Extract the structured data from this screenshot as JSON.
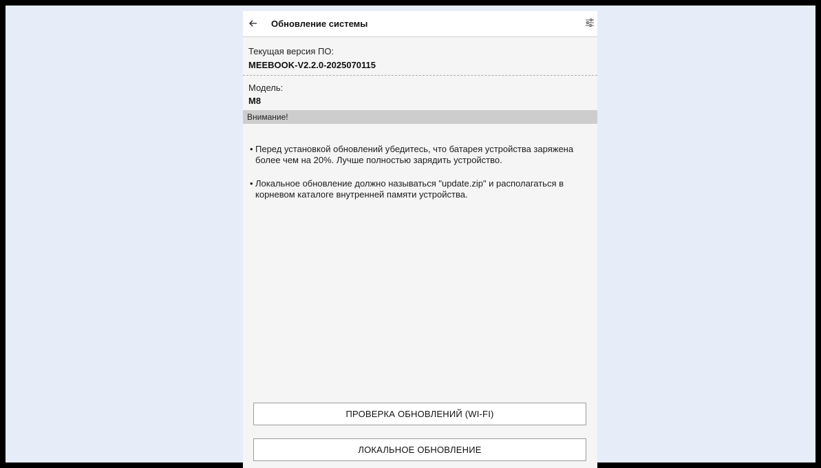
{
  "header": {
    "title": "Обновление системы",
    "back_icon": "arrow-left-icon",
    "settings_icon": "sliders-icon"
  },
  "version": {
    "label": "Текущая версия ПО:",
    "value": "MEEBOOK-V2.2.0-2025070115"
  },
  "model": {
    "label": "Модель:",
    "value": "M8"
  },
  "warning": {
    "title": "Внимание!",
    "notes": [
      {
        "bullet": "•",
        "text": "Перед установкой обновлений убедитесь, что батарея устройства заряжена более чем на 20%. Лучше полностью зарядить устройство."
      },
      {
        "bullet": "•",
        "text": "Локальное обновление должно называться \"update.zip\" и располагаться в корневом каталоге внутренней памяти устройства."
      }
    ]
  },
  "buttons": {
    "check_wifi": "ПРОВЕРКА ОБНОВЛЕНИЙ (WI-FI)",
    "local_update": "ЛОКАЛЬНОЕ ОБНОВЛЕНИЕ"
  },
  "colors": {
    "background": "#e6edf9",
    "screen": "#f5f5f5",
    "warning_bar": "#cdcdcd"
  }
}
